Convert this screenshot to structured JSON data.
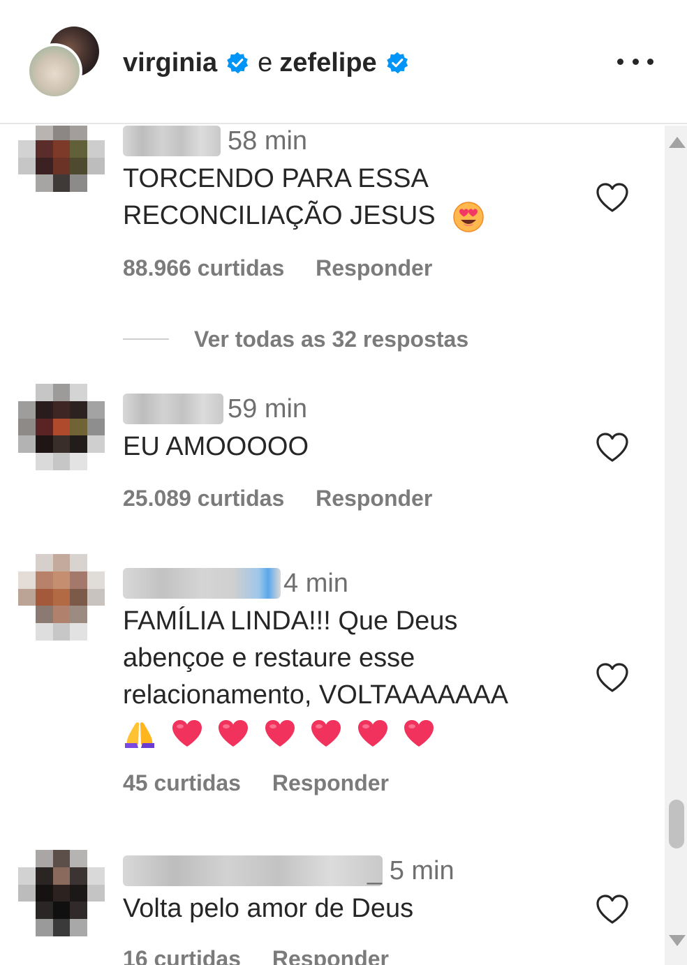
{
  "header": {
    "user1": "virginia",
    "joiner": "e",
    "user2": "zefelipe",
    "verified_color": "#0095f6"
  },
  "comments": [
    {
      "time": "58 min",
      "text": "TORCENDO PARA ESSA RECONCILIAÇÃO JESUS",
      "emoji": "heart-eyes-emoji",
      "likes": "88.966 curtidas",
      "reply": "Responder"
    },
    {
      "time": "59 min",
      "text": "EU AMOOOOO",
      "likes": "25.089 curtidas",
      "reply": "Responder"
    },
    {
      "time": "4 min",
      "text": "FAMÍLIA LINDA!!! Que Deus abençoe e restaure esse relacionamento, VOLTAAAAAAA",
      "emojis": [
        "folded-hands-emoji",
        "heart-emoji",
        "heart-emoji",
        "heart-emoji",
        "heart-emoji",
        "heart-emoji",
        "heart-emoji"
      ],
      "likes": "45 curtidas",
      "reply": "Responder"
    },
    {
      "time": "5 min",
      "text": "Volta pelo amor de Deus",
      "likes": "16 curtidas",
      "reply": "Responder"
    }
  ],
  "view_replies": "Ver todas as 32 respostas",
  "colors": {
    "text": "#262626",
    "secondary": "#7b7b7b",
    "heart_emoji": "#f0325c"
  }
}
